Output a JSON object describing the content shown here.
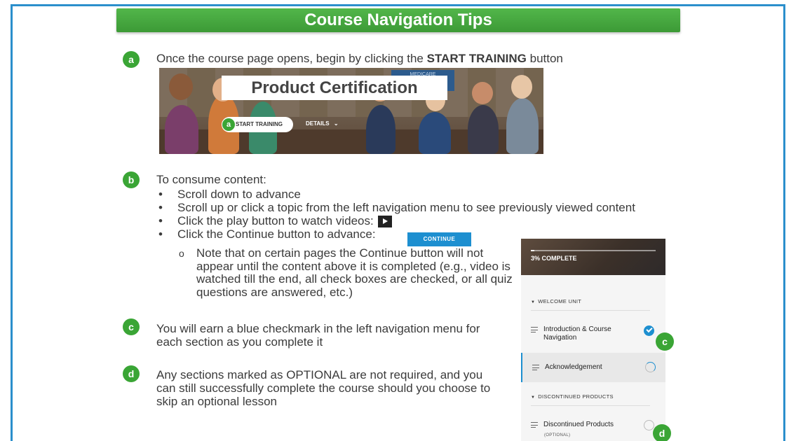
{
  "banner": {
    "title": "Course Navigation Tips"
  },
  "badges": {
    "a": "a",
    "b": "b",
    "c": "c",
    "d": "d"
  },
  "step_a": {
    "text_before": "Once the course page opens, begin by clicking the ",
    "bold": "START TRAINING",
    "text_after": " button"
  },
  "hero": {
    "title": "Product Certification",
    "start_button": "START TRAINING",
    "details_button": "DETAILS",
    "medicare_sign": "MEDICARE"
  },
  "step_b": {
    "intro": "To consume content:",
    "bullets": [
      "Scroll down to advance",
      "Scroll up or click a topic from the left navigation menu to see previously viewed content",
      "Click the play button to watch videos:",
      "Click the Continue button to advance:"
    ],
    "continue_label": "CONTINUE",
    "subnote_marker": "o",
    "subnote": "Note that on certain pages the Continue button will not appear until the content above it is completed (e.g., video is watched till the end, all check boxes are checked, or all quiz questions are answered, etc.)"
  },
  "step_c": {
    "text": "You will earn a blue checkmark in the left navigation menu for each section as you complete it"
  },
  "step_d": {
    "text": "Any sections marked as OPTIONAL are not required, and you can still successfully complete the course should you choose to skip an optional lesson"
  },
  "sidenav": {
    "progress_label": "3% COMPLETE",
    "progress": 0.03,
    "sections": [
      {
        "title": "WELCOME UNIT"
      },
      {
        "title": "DISCONTINUED PRODUCTS"
      }
    ],
    "items": [
      {
        "label": "Introduction & Course Navigation",
        "status": "complete"
      },
      {
        "label": "Acknowledgement",
        "status": "in-progress"
      },
      {
        "label": "Discontinued Products",
        "tag": "(OPTIONAL)",
        "status": "not-started"
      }
    ]
  },
  "colors": {
    "accent_green": "#3aa535",
    "frame_blue": "#2b8fcc",
    "nav_blue": "#1d8fd0"
  }
}
